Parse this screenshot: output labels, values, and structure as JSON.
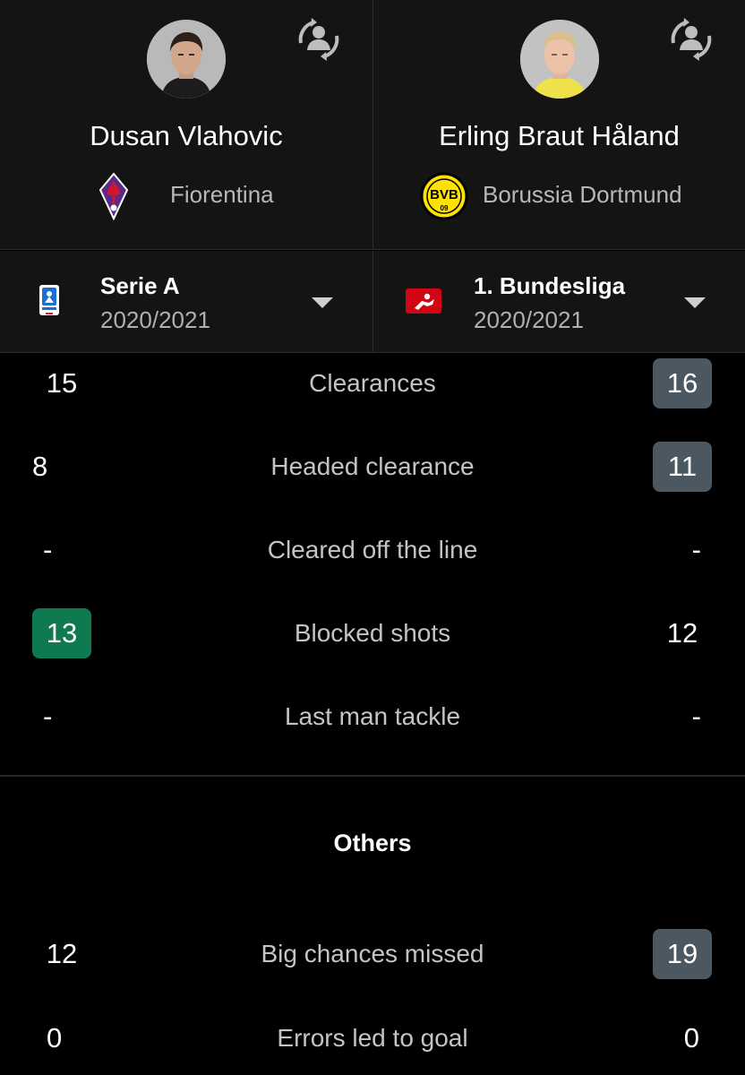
{
  "players": [
    {
      "name": "Dusan Vlahovic",
      "team": "Fiorentina",
      "team_logo_icon": "fiorentina-crest-icon",
      "swap_icon": "swap-player-icon"
    },
    {
      "name": "Erling Braut Håland",
      "team": "Borussia Dortmund",
      "team_logo_icon": "bvb-crest-icon",
      "swap_icon": "swap-player-icon"
    }
  ],
  "leagues": [
    {
      "name": "Serie A",
      "season": "2020/2021",
      "logo_icon": "serie-a-logo-icon"
    },
    {
      "name": "1. Bundesliga",
      "season": "2020/2021",
      "logo_icon": "bundesliga-logo-icon"
    }
  ],
  "stats": [
    {
      "label": "Clearances",
      "left": "15",
      "right": "16",
      "highlight": "right"
    },
    {
      "label": "Headed clearance",
      "left": "8",
      "right": "11",
      "highlight": "right"
    },
    {
      "label": "Cleared off the line",
      "left": "-",
      "right": "-",
      "highlight": "none"
    },
    {
      "label": "Blocked shots",
      "left": "13",
      "right": "12",
      "highlight": "left"
    },
    {
      "label": "Last man tackle",
      "left": "-",
      "right": "-",
      "highlight": "none"
    }
  ],
  "others": {
    "title": "Others",
    "stats": [
      {
        "label": "Big chances missed",
        "left": "12",
        "right": "19",
        "highlight": "right"
      },
      {
        "label": "Errors led to goal",
        "left": "0",
        "right": "0",
        "highlight": "none"
      }
    ]
  },
  "colors": {
    "highlight_better_left": "#0f7a4f",
    "highlight_better_right": "#4b5861",
    "background": "#000000",
    "header_bg": "#141414"
  }
}
